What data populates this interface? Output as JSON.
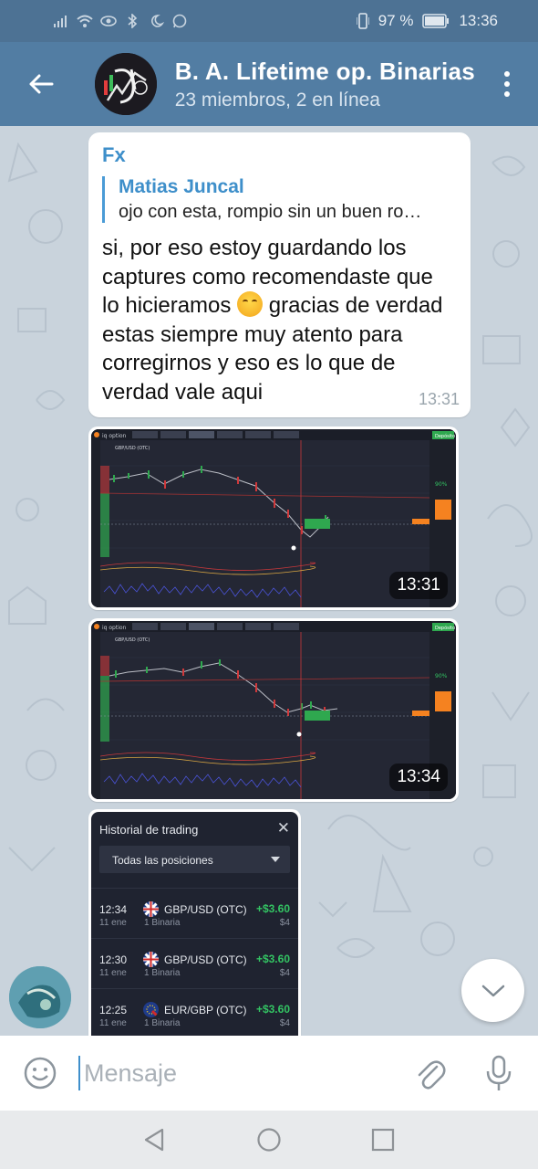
{
  "status_bar": {
    "battery": "97 %",
    "time": "13:36"
  },
  "header": {
    "title": "B. A. Lifetime op. Binarias",
    "subtitle": "23 miembros, 2 en línea",
    "icons": {
      "back": "arrow-left-icon",
      "menu": "more-vert-icon"
    }
  },
  "message": {
    "sender": "Fx",
    "reply": {
      "name": "Matias Juncal",
      "text": "ojo con esta, rompio sin un buen ro…"
    },
    "text_before_emoji": "si, por eso estoy guardando los captures como recomendaste que lo hicieramos ",
    "text_after_emoji": " gracias de verdad estas siempre muy atento para corregirnos y eso es lo que de verdad vale aqui",
    "time": "13:31"
  },
  "photos": [
    {
      "time": "13:31",
      "platform": "iq option",
      "deposit_label": "Depósito",
      "pair": "GBP/USD (OTC)",
      "payout": "90%"
    },
    {
      "time": "13:34",
      "platform": "iq option",
      "deposit_label": "Depósito",
      "pair": "GBP/USD (OTC)",
      "payout": "90%"
    }
  ],
  "history": {
    "title": "Historial de trading",
    "filter": "Todas las posiciones",
    "rows": [
      {
        "time": "12:34",
        "date": "11 ene",
        "pair": "GBP/USD (OTC)",
        "type": "1 Binaria",
        "profit": "+$3.60",
        "amount": "$4"
      },
      {
        "time": "12:30",
        "date": "11 ene",
        "pair": "GBP/USD (OTC)",
        "type": "1 Binaria",
        "profit": "+$3.60",
        "amount": "$4"
      },
      {
        "time": "12:25",
        "date": "11 ene",
        "pair": "EUR/GBP (OTC)",
        "type": "1 Binaria",
        "profit": "+$3.60",
        "amount": "$4"
      }
    ]
  },
  "input": {
    "placeholder": "Mensaje"
  },
  "colors": {
    "header": "#527da3",
    "status_bar": "#4d7294",
    "accent": "#3e8fca",
    "profit": "#33c463"
  }
}
